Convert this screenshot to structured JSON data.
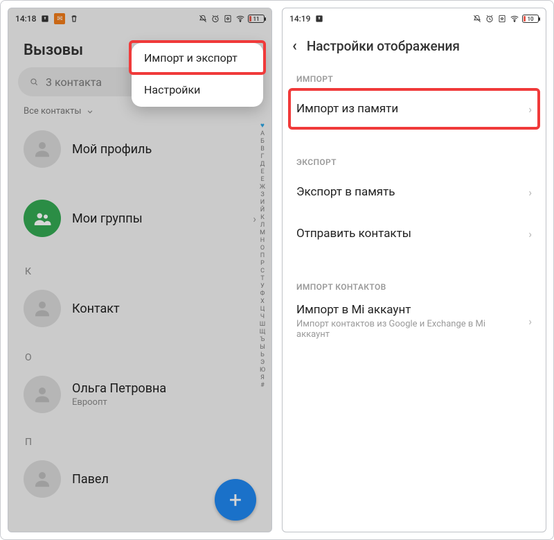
{
  "left": {
    "status": {
      "time": "14:18",
      "battery": "11"
    },
    "title": "Вызовы",
    "search_placeholder": "3 контакта",
    "filter_label": "Все контакты",
    "popup": {
      "import_export": "Импорт и экспорт",
      "settings": "Настройки"
    },
    "profile_label": "Мой профиль",
    "groups_label": "Мои группы",
    "sections": {
      "K": {
        "letter": "К",
        "contact": "Контакт"
      },
      "O": {
        "letter": "О",
        "name": "Ольга Петровна",
        "sub": "Евроопт"
      },
      "P": {
        "letter": "П",
        "name": "Павел"
      }
    },
    "alpha_index": [
      "А",
      "Б",
      "В",
      "Г",
      "Д",
      "Е",
      "Е",
      "Ж",
      "З",
      "И",
      "Й",
      "К",
      "Л",
      "М",
      "Н",
      "О",
      "П",
      "Р",
      "С",
      "Т",
      "У",
      "Ф",
      "Х",
      "Ц",
      "Ч",
      "Ш",
      "Щ",
      "Ъ",
      "Ы",
      "Ь",
      "Э",
      "Ю",
      "Я",
      "#"
    ]
  },
  "right": {
    "status": {
      "time": "14:19",
      "battery": "10"
    },
    "header_title": "Настройки отображения",
    "sections": {
      "import_label": "ИМПОРТ",
      "import_from_memory": "Импорт из памяти",
      "export_label": "ЭКСПОРТ",
      "export_to_memory": "Экспорт в память",
      "send_contacts": "Отправить контакты",
      "import_contacts_label": "ИМПОРТ КОНТАКТОВ",
      "import_mi": "Импорт в Mi аккаунт",
      "import_mi_sub": "Импорт контактов из Google и Exchange в Mi аккаунт"
    }
  }
}
